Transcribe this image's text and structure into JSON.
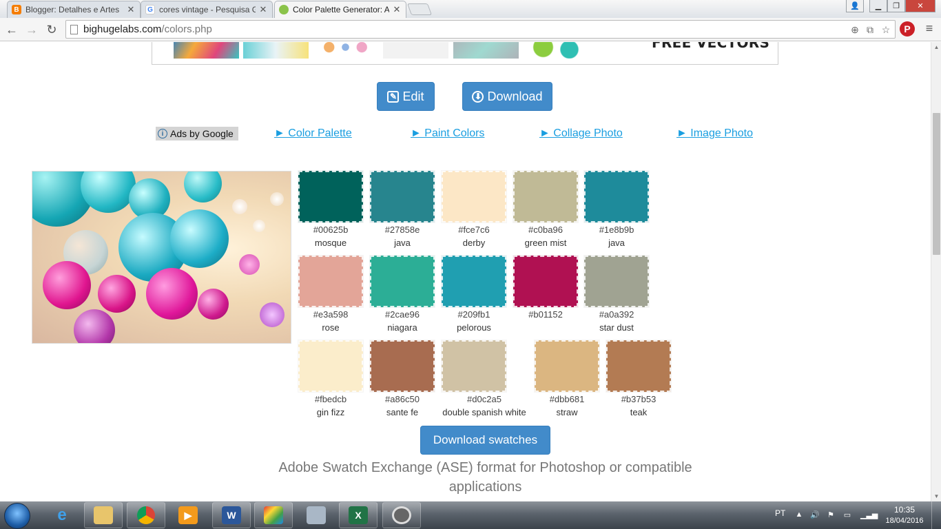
{
  "browser": {
    "tabs": [
      {
        "label": "Blogger: Detalhes e Artes",
        "favicon_color": "#f57d00",
        "favicon_letter": "B",
        "active": false
      },
      {
        "label": "cores vintage - Pesquisa G",
        "favicon_color": "#4285f4",
        "favicon_letter": "G",
        "active": false
      },
      {
        "label": "Color Palette Generator: A",
        "favicon_color": "#8bc34a",
        "favicon_letter": "",
        "active": true
      }
    ],
    "url_host": "bighugelabs.com",
    "url_path": "/colors.php",
    "pinterest_letter": "P"
  },
  "ad_banner": {
    "text": "FREE VECTORS",
    "thumb_colors": [
      "#3a86c8",
      "#6ad0d6",
      "#f4b16a",
      "#e9e9e9",
      "#9fd9d0",
      "#8ccd3f"
    ]
  },
  "actions": {
    "edit_label": "Edit",
    "download_label": "Download",
    "edit_icon": "✎",
    "download_icon": "⬇"
  },
  "ads_row": {
    "ads_by_google": "Ads by Google",
    "links": [
      "► Color Palette",
      "► Paint Colors",
      "► Collage Photo",
      "► Image Photo"
    ]
  },
  "palette": [
    {
      "hex": "#00625b",
      "name": "mosque"
    },
    {
      "hex": "#27858e",
      "name": "java"
    },
    {
      "hex": "#fce7c6",
      "name": "derby"
    },
    {
      "hex": "#c0ba96",
      "name": "green mist"
    },
    {
      "hex": "#1e8b9b",
      "name": "java"
    },
    {
      "hex": "#e3a598",
      "name": "rose"
    },
    {
      "hex": "#2cae96",
      "name": "niagara"
    },
    {
      "hex": "#209fb1",
      "name": "pelorous"
    },
    {
      "hex": "#b01152",
      "name": ""
    },
    {
      "hex": "#a0a392",
      "name": "star dust"
    },
    {
      "hex": "#fbedcb",
      "name": "gin fizz"
    },
    {
      "hex": "#a86c50",
      "name": "sante fe"
    },
    {
      "hex": "#d0c2a5",
      "name": "double spanish white"
    },
    {
      "hex": "#dbb681",
      "name": "straw"
    },
    {
      "hex": "#b37b53",
      "name": "teak"
    }
  ],
  "download_swatches": "Download swatches",
  "ase_text": "Adobe Swatch Exchange (ASE) format for Photoshop or compatible applications",
  "taskbar": {
    "language": "PT",
    "time": "10:35",
    "date": "18/04/2016"
  }
}
